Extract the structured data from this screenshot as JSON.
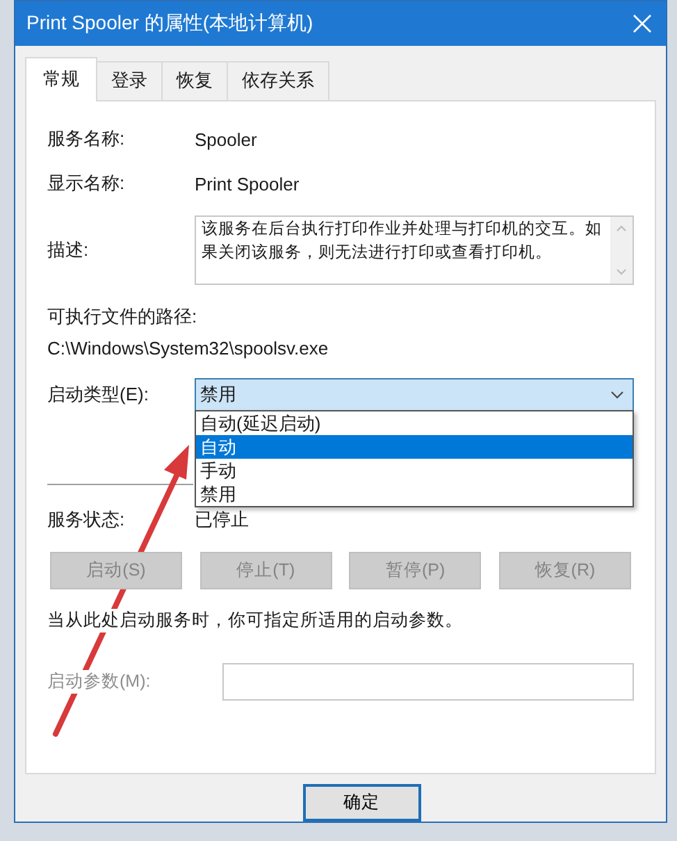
{
  "window": {
    "title": "Print Spooler 的属性(本地计算机)"
  },
  "tabs": [
    {
      "label": "常规",
      "selected": true
    },
    {
      "label": "登录",
      "selected": false
    },
    {
      "label": "恢复",
      "selected": false
    },
    {
      "label": "依存关系",
      "selected": false
    }
  ],
  "service_name": {
    "label": "服务名称:",
    "value": "Spooler"
  },
  "display_name": {
    "label": "显示名称:",
    "value": "Print Spooler"
  },
  "description": {
    "label": "描述:",
    "value": "该服务在后台执行打印作业并处理与打印机的交互。如果关闭该服务，则无法进行打印或查看打印机。"
  },
  "executable_path": {
    "label": "可执行文件的路径:",
    "value": "C:\\Windows\\System32\\spoolsv.exe"
  },
  "startup_type": {
    "label": "启动类型(E):",
    "value": "禁用",
    "expanded": true,
    "options": [
      {
        "label": "自动(延迟启动)",
        "highlighted": false
      },
      {
        "label": "自动",
        "highlighted": true
      },
      {
        "label": "手动",
        "highlighted": false
      },
      {
        "label": "禁用",
        "highlighted": false
      }
    ]
  },
  "service_status": {
    "label": "服务状态:",
    "value": "已停止"
  },
  "service_buttons": [
    {
      "label": "启动(S)",
      "disabled": true
    },
    {
      "label": "停止(T)",
      "disabled": true
    },
    {
      "label": "暂停(P)",
      "disabled": true
    },
    {
      "label": "恢复(R)",
      "disabled": true
    }
  ],
  "hint": "当从此处启动服务时，你可指定所适用的启动参数。",
  "start_parameters": {
    "label": "启动参数(M):",
    "disabled": true
  },
  "dialog_buttons": [
    {
      "label": "确定"
    }
  ]
}
